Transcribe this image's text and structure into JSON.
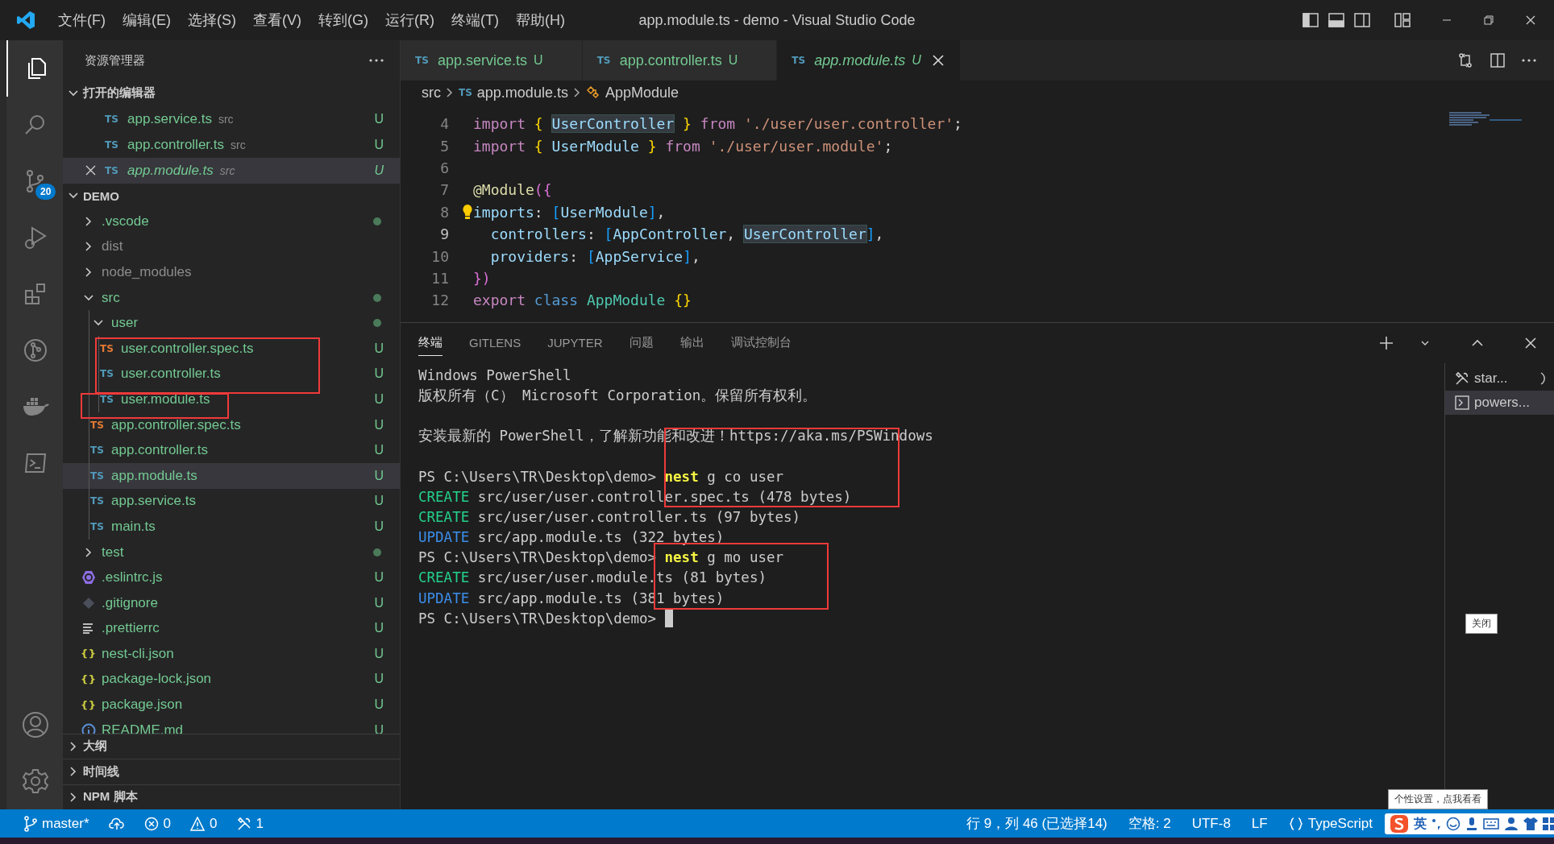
{
  "title_bar": {
    "menus": [
      "文件(F)",
      "编辑(E)",
      "选择(S)",
      "查看(V)",
      "转到(G)",
      "运行(R)",
      "终端(T)",
      "帮助(H)"
    ],
    "title": "app.module.ts - demo - Visual Studio Code"
  },
  "activity_bar": {
    "top": [
      {
        "kind": "files",
        "selected": true
      },
      {
        "kind": "search",
        "selected": false
      },
      {
        "kind": "scm",
        "selected": false,
        "badge": "20"
      },
      {
        "kind": "debug",
        "selected": false
      },
      {
        "kind": "extensions",
        "selected": false
      },
      {
        "kind": "gitlens",
        "selected": false
      },
      {
        "kind": "docker",
        "selected": false
      },
      {
        "kind": "terminal",
        "selected": false
      }
    ],
    "bottom": [
      {
        "kind": "account",
        "selected": false
      },
      {
        "kind": "settings",
        "selected": false
      }
    ]
  },
  "sidebar": {
    "title": "资源管理器",
    "open_editors": {
      "title": "打开的编辑器",
      "expanded": true,
      "items": [
        {
          "name": "app.service.ts",
          "icon": "TS",
          "dir": "src",
          "badge": "U",
          "preview": false,
          "selected": false
        },
        {
          "name": "app.controller.ts",
          "icon": "TS",
          "dir": "src",
          "badge": "U",
          "preview": false,
          "selected": false
        },
        {
          "name": "app.module.ts",
          "icon": "TS",
          "dir": "src",
          "badge": "U",
          "preview": true,
          "selected": true
        }
      ]
    },
    "project": {
      "title": "DEMO",
      "expanded": true,
      "tree": [
        {
          "name": ".vscode",
          "kind": "folder",
          "expanded": false,
          "modified": true,
          "selected": false
        },
        {
          "name": "dist",
          "kind": "folder",
          "expanded": false,
          "modified": false,
          "selected": false
        },
        {
          "name": "node_modules",
          "kind": "folder",
          "expanded": false,
          "modified": false,
          "selected": false
        },
        {
          "name": "src",
          "kind": "folder",
          "expanded": true,
          "modified": true,
          "selected": false,
          "children": [
            {
              "name": "user",
              "kind": "folder",
              "expanded": true,
              "modified": true,
              "selected": false,
              "children": [
                {
                  "name": "user.controller.spec.ts",
                  "kind": "ts-spec",
                  "icon": "TS",
                  "badge": "U",
                  "selected": false
                },
                {
                  "name": "user.controller.ts",
                  "kind": "ts",
                  "icon": "TS",
                  "badge": "U",
                  "selected": false
                },
                {
                  "name": "user.module.ts",
                  "kind": "ts",
                  "icon": "TS",
                  "badge": "U",
                  "selected": false
                }
              ]
            },
            {
              "name": "app.controller.spec.ts",
              "kind": "ts-spec",
              "icon": "TS",
              "badge": "U",
              "selected": false
            },
            {
              "name": "app.controller.ts",
              "kind": "ts",
              "icon": "TS",
              "badge": "U",
              "selected": false
            },
            {
              "name": "app.module.ts",
              "kind": "ts",
              "icon": "TS",
              "badge": "U",
              "selected": true
            },
            {
              "name": "app.service.ts",
              "kind": "ts",
              "icon": "TS",
              "badge": "U",
              "selected": false
            },
            {
              "name": "main.ts",
              "kind": "ts",
              "icon": "TS",
              "badge": "U",
              "selected": false
            }
          ]
        },
        {
          "name": "test",
          "kind": "folder",
          "expanded": false,
          "modified": true,
          "selected": false
        },
        {
          "name": ".eslintrc.js",
          "kind": "eslint",
          "badge": "U",
          "selected": false
        },
        {
          "name": ".gitignore",
          "kind": "git",
          "badge": "U",
          "selected": false
        },
        {
          "name": ".prettierrc",
          "kind": "config",
          "badge": "U",
          "selected": false
        },
        {
          "name": "nest-cli.json",
          "kind": "json",
          "icon": "{ }",
          "badge": "U",
          "selected": false
        },
        {
          "name": "package-lock.json",
          "kind": "json",
          "icon": "{ }",
          "badge": "U",
          "selected": false
        },
        {
          "name": "package.json",
          "kind": "json",
          "icon": "{ }",
          "badge": "U",
          "selected": false
        },
        {
          "name": "README.md",
          "kind": "info",
          "badge": "U",
          "selected": false
        }
      ]
    },
    "sections": [
      {
        "title": "大纲",
        "expanded": false
      },
      {
        "title": "时间线",
        "expanded": false
      },
      {
        "title": "NPM 脚本",
        "expanded": false
      }
    ]
  },
  "editor": {
    "tabs": [
      {
        "label": "app.service.ts",
        "icon": "TS",
        "badge": "U",
        "preview": false,
        "selected": false
      },
      {
        "label": "app.controller.ts",
        "icon": "TS",
        "badge": "U",
        "preview": false,
        "selected": false
      },
      {
        "label": "app.module.ts",
        "icon": "TS",
        "badge": "U",
        "preview": true,
        "selected": true
      }
    ],
    "breadcrumbs": [
      {
        "label": "src",
        "kind": "folder"
      },
      {
        "label": "app.module.ts",
        "kind": "file",
        "icon": "TS"
      },
      {
        "label": "AppModule",
        "kind": "symbol"
      }
    ],
    "lines": [
      {
        "number": "4",
        "current": false,
        "tokens": [
          {
            "text": "import ",
            "kind": "keyword"
          },
          {
            "text": "{ ",
            "kind": "brace"
          },
          {
            "text": "UserController",
            "kind": "ident",
            "hl": true
          },
          {
            "text": " }",
            "kind": "brace"
          },
          {
            "text": " from ",
            "kind": "keyword"
          },
          {
            "text": "'./user/user.controller'",
            "kind": "string"
          },
          {
            "text": ";",
            "kind": "plain"
          }
        ]
      },
      {
        "number": "5",
        "current": false,
        "tokens": [
          {
            "text": "import ",
            "kind": "keyword"
          },
          {
            "text": "{ ",
            "kind": "brace"
          },
          {
            "text": "UserModule",
            "kind": "ident"
          },
          {
            "text": " }",
            "kind": "brace"
          },
          {
            "text": " from ",
            "kind": "keyword"
          },
          {
            "text": "'./user/user.module'",
            "kind": "string"
          },
          {
            "text": ";",
            "kind": "plain"
          }
        ]
      },
      {
        "number": "6",
        "current": false
      },
      {
        "number": "7",
        "current": false,
        "tokens": [
          {
            "text": "@Module",
            "kind": "decorator"
          },
          {
            "text": "({",
            "kind": "paren"
          }
        ]
      },
      {
        "number": "8",
        "current": false,
        "lightbulb": true,
        "tokens": [
          {
            "text": "imports",
            "kind": "ident"
          },
          {
            "text": ": ",
            "kind": "plain"
          },
          {
            "text": "[",
            "kind": "bracket"
          },
          {
            "text": "UserModule",
            "kind": "ident"
          },
          {
            "text": "]",
            "kind": "bracket"
          },
          {
            "text": ",",
            "kind": "plain"
          }
        ]
      },
      {
        "number": "9",
        "current": true,
        "tokens": [
          {
            "text": "  controllers",
            "kind": "ident"
          },
          {
            "text": ": ",
            "kind": "plain"
          },
          {
            "text": "[",
            "kind": "bracket"
          },
          {
            "text": "AppController",
            "kind": "ident"
          },
          {
            "text": ", ",
            "kind": "plain"
          },
          {
            "text": "UserController",
            "kind": "ident",
            "hl": true
          },
          {
            "text": "]",
            "kind": "bracket"
          },
          {
            "text": ",",
            "kind": "plain"
          }
        ]
      },
      {
        "number": "10",
        "current": false,
        "tokens": [
          {
            "text": "  providers",
            "kind": "ident"
          },
          {
            "text": ": ",
            "kind": "plain"
          },
          {
            "text": "[",
            "kind": "bracket"
          },
          {
            "text": "AppService",
            "kind": "ident"
          },
          {
            "text": "]",
            "kind": "bracket"
          },
          {
            "text": ",",
            "kind": "plain"
          }
        ]
      },
      {
        "number": "11",
        "current": false,
        "tokens": [
          {
            "text": "})",
            "kind": "paren"
          }
        ]
      },
      {
        "number": "12",
        "current": false,
        "tokens": [
          {
            "text": "export ",
            "kind": "keyword"
          },
          {
            "text": "class ",
            "kind": "keyword2"
          },
          {
            "text": "AppModule ",
            "kind": "class"
          },
          {
            "text": "{}",
            "kind": "brace"
          }
        ]
      }
    ]
  },
  "panel": {
    "tabs": [
      {
        "label": "终端",
        "selected": true
      },
      {
        "label": "GITLENS",
        "selected": false
      },
      {
        "label": "JUPYTER",
        "selected": false
      },
      {
        "label": "问题",
        "selected": false
      },
      {
        "label": "输出",
        "selected": false
      },
      {
        "label": "调试控制台",
        "selected": false
      }
    ],
    "terminal_lines": [
      {
        "cursor": false,
        "tokens": [
          {
            "text": "Windows PowerShell",
            "kind": "plain"
          }
        ]
      },
      {
        "cursor": false,
        "tokens": [
          {
            "text": "版权所有（C） Microsoft Corporation。保留所有权利。",
            "kind": "plain"
          }
        ]
      },
      {
        "kind": "blank"
      },
      {
        "cursor": false,
        "tokens": [
          {
            "text": "安装最新的 PowerShell，了解新功能和改进！https://aka.ms/PSWindows",
            "kind": "plain"
          }
        ]
      },
      {
        "kind": "blank"
      },
      {
        "cursor": false,
        "tokens": [
          {
            "text": "PS C:\\Users\\TR\\Desktop\\demo> ",
            "kind": "plain"
          },
          {
            "text": "nest",
            "kind": "command"
          },
          {
            "text": " g co user",
            "kind": "plain"
          }
        ]
      },
      {
        "cursor": false,
        "tokens": [
          {
            "text": "CREATE",
            "kind": "create"
          },
          {
            "text": " src/user/user.controller.spec.ts (478 bytes)",
            "kind": "plain"
          }
        ]
      },
      {
        "cursor": false,
        "tokens": [
          {
            "text": "CREATE",
            "kind": "create"
          },
          {
            "text": " src/user/user.controller.ts (97 bytes)",
            "kind": "plain"
          }
        ]
      },
      {
        "cursor": false,
        "tokens": [
          {
            "text": "UPDATE",
            "kind": "update"
          },
          {
            "text": " src/app.module.ts (322 bytes)",
            "kind": "plain"
          }
        ]
      },
      {
        "cursor": false,
        "tokens": [
          {
            "text": "PS C:\\Users\\TR\\Desktop\\demo> ",
            "kind": "plain"
          },
          {
            "text": "nest",
            "kind": "command"
          },
          {
            "text": " g mo user",
            "kind": "plain"
          }
        ]
      },
      {
        "cursor": false,
        "tokens": [
          {
            "text": "CREATE",
            "kind": "create"
          },
          {
            "text": " src/user/user.module.ts (81 bytes)",
            "kind": "plain"
          }
        ]
      },
      {
        "cursor": false,
        "tokens": [
          {
            "text": "UPDATE",
            "kind": "update"
          },
          {
            "text": " src/app.module.ts (381 bytes)",
            "kind": "plain"
          }
        ]
      },
      {
        "cursor": true,
        "tokens": [
          {
            "text": "PS C:\\Users\\TR\\Desktop\\demo> ",
            "kind": "plain"
          }
        ]
      }
    ],
    "terminals": [
      {
        "label": "star...",
        "kind": "task",
        "selected": false
      },
      {
        "label": "powers...",
        "kind": "shell",
        "selected": true
      }
    ]
  },
  "status_bar": {
    "left": [
      {
        "kind": "branch",
        "text": "master*"
      },
      {
        "kind": "sync"
      },
      {
        "kind": "errors",
        "text": "0"
      },
      {
        "kind": "warnings",
        "text": "0"
      },
      {
        "kind": "tools",
        "text": "1"
      }
    ],
    "right": [
      {
        "kind": "text",
        "text": "行 9，列 46 (已选择14)"
      },
      {
        "kind": "text",
        "text": "空格: 2"
      },
      {
        "kind": "text",
        "text": "UTF-8"
      },
      {
        "kind": "text",
        "text": "LF"
      },
      {
        "kind": "language",
        "text": "TypeScript"
      }
    ]
  },
  "tooltips": [
    {
      "kind": "close",
      "text": "关闭"
    },
    {
      "kind": "ime",
      "text": "个性设置，点我看看"
    }
  ],
  "ime_toolbar": {
    "mode": "英"
  }
}
